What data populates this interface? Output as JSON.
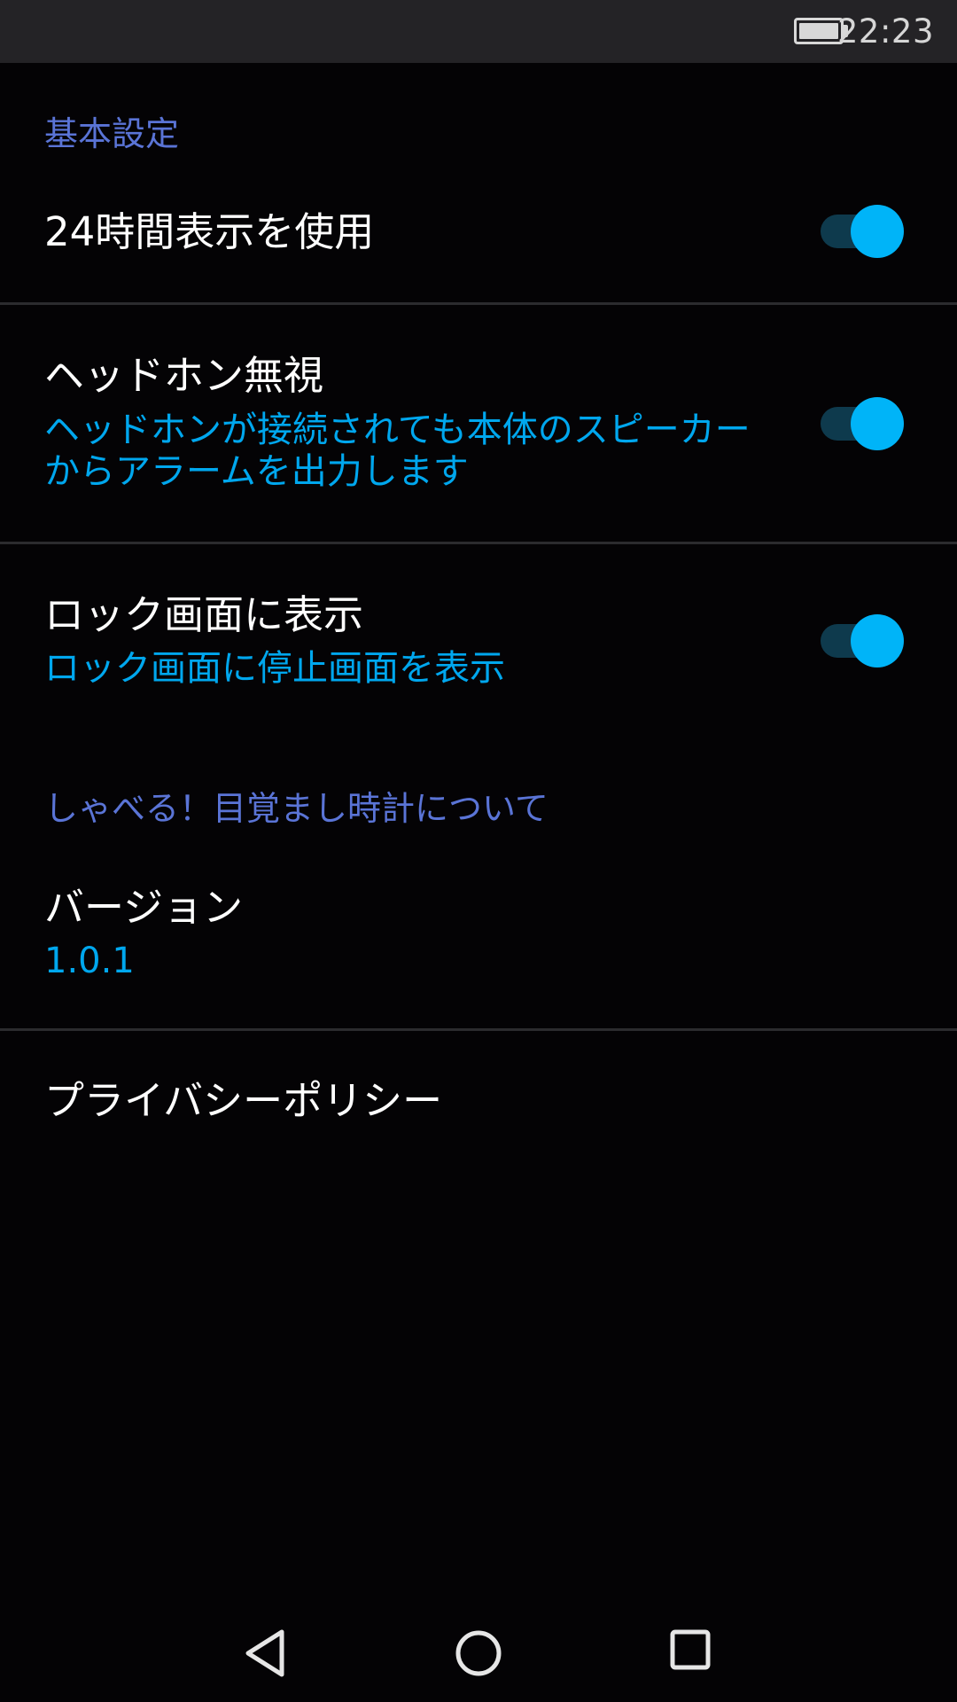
{
  "status_bar": {
    "time": "22:23",
    "battery_icon": "battery-full-icon"
  },
  "sections": {
    "basic": {
      "header": "基本設定"
    },
    "about": {
      "header": "しゃべる！目覚まし時計について"
    }
  },
  "settings": {
    "use_24h": {
      "title": "24時間表示を使用",
      "enabled": true
    },
    "ignore_headphone": {
      "title": "ヘッドホン無視",
      "summary": "ヘッドホンが接続されても本体のスピーカーからアラームを出力します",
      "enabled": true
    },
    "show_on_lockscreen": {
      "title": "ロック画面に表示",
      "summary": "ロック画面に停止画面を表示",
      "enabled": true
    }
  },
  "about": {
    "version": {
      "title": "バージョン",
      "value": "1.0.1"
    },
    "privacy": {
      "title": "プライバシーポリシー"
    }
  },
  "navigation_bar": {
    "back_icon": "back-triangle-icon",
    "home_icon": "home-circle-icon",
    "recent_icon": "recent-apps-square-icon"
  },
  "colors": {
    "background": "#040305",
    "status_bar": "#242326",
    "section_header": "#5a74d6",
    "summary_text": "#00a7ee",
    "switch_thumb": "#00b4f8",
    "switch_track": "#0e3a4d"
  }
}
